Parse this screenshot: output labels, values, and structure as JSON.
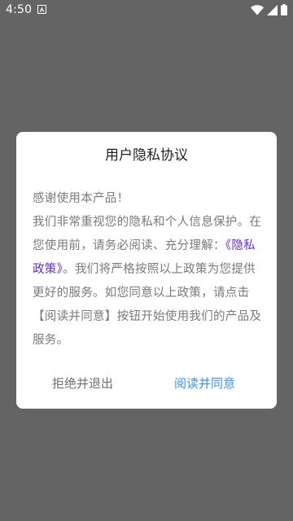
{
  "status_bar": {
    "time": "4:50",
    "icons": [
      "notification-a-icon",
      "wifi-icon",
      "cellular-signal-icon",
      "battery-icon"
    ]
  },
  "dialog": {
    "title": "用户隐私协议",
    "body": {
      "line1": "感谢使用本产品！",
      "line2_prefix": "我们非常重视您的隐私和个人信息保护。在您使用前，请务必阅读、充分理解：",
      "policy_link": "《隐私政策》",
      "line2_suffix": "。我们将严格按照以上政策为您提供更好的服务。如您同意以上政策，请点击【阅读并同意】按钮开始使用我们的产品及服务。"
    },
    "decline_label": "拒绝并退出",
    "agree_label": "阅读并同意"
  },
  "colors": {
    "overlay": "#646464",
    "link": "#6a2bd6",
    "agree": "#3b95e8",
    "decline": "#6f6f6f",
    "body_text": "#7a7a7a"
  }
}
